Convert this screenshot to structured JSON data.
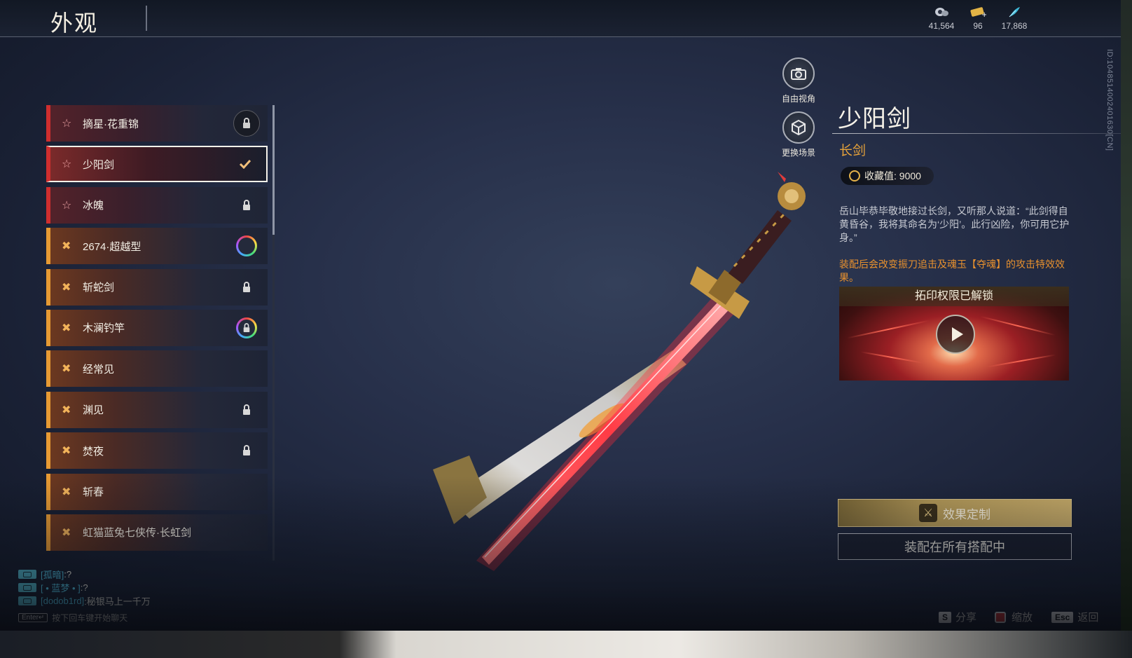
{
  "header": {
    "title": "外观"
  },
  "currencies": [
    {
      "icon": "eye-token-icon",
      "value": "41,564"
    },
    {
      "icon": "ticket-icon",
      "value": "96"
    },
    {
      "icon": "feather-icon",
      "value": "17,868"
    }
  ],
  "side_id": "ID:1048514002401630[CN]",
  "tools": {
    "free_view": "自由视角",
    "change_scene": "更换场景"
  },
  "list": {
    "items": [
      {
        "name": "摘星·花重锦",
        "rarity": "red",
        "status": "lock-ring"
      },
      {
        "name": "少阳剑",
        "rarity": "red",
        "status": "check",
        "selected": true
      },
      {
        "name": "冰魄",
        "rarity": "red",
        "status": "lock"
      },
      {
        "name": "2674·超越型",
        "rarity": "orange",
        "status": "rainbow-ring"
      },
      {
        "name": "斩蛇剑",
        "rarity": "orange",
        "status": "lock"
      },
      {
        "name": "木澜钓竿",
        "rarity": "orange",
        "status": "rainbow-lock"
      },
      {
        "name": "经常见",
        "rarity": "orange",
        "status": "none"
      },
      {
        "name": "渊见",
        "rarity": "orange",
        "status": "lock"
      },
      {
        "name": "焚夜",
        "rarity": "orange",
        "status": "lock"
      },
      {
        "name": "斩春",
        "rarity": "orange",
        "status": "none"
      },
      {
        "name": "虹猫蓝兔七侠传·长虹剑",
        "rarity": "orange",
        "status": "none"
      }
    ]
  },
  "detail": {
    "name": "少阳剑",
    "type": "长剑",
    "collection_label": "收藏值: 9000",
    "description": "岳山毕恭毕敬地接过长剑，又听那人说道：“此剑得自黄昏谷，我将其命名为‘少阳’。此行凶险，你可用它护身。”",
    "effect": "装配后会改变振刀追击及魂玉【夺魂】的攻击特效效果。",
    "video_title": "拓印权限已解锁",
    "btn_effect": "效果定制",
    "btn_equip": "装配在所有搭配中"
  },
  "chat": {
    "lines": [
      {
        "name": "[孤暗]",
        "msg": ":?"
      },
      {
        "name": "[ • 蓝梦 • ]",
        "msg": ":?"
      },
      {
        "name": "[dodob1rd]",
        "msg": ":秘银马上一千万"
      }
    ],
    "enter_key": "Enter↵",
    "enter_hint": "按下回车键开始聊天"
  },
  "hints": [
    {
      "key": "S",
      "label": "分享"
    },
    {
      "key": "",
      "label": "缩放"
    },
    {
      "key": "Esc",
      "label": "返回"
    }
  ],
  "colors": {
    "accent_gold": "#e6a23a",
    "accent_red": "#cf2e2e",
    "accent_orange": "#e79a33"
  }
}
